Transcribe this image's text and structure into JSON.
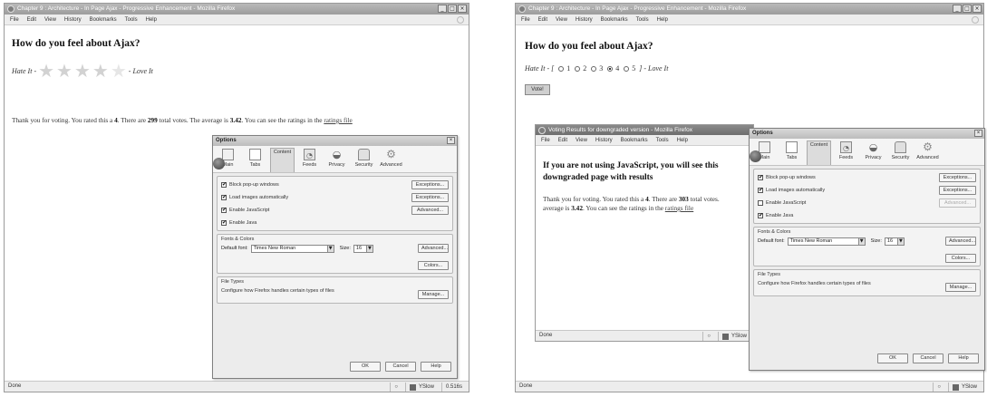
{
  "left_window": {
    "title": "Chapter 9 : Architecture - In Page Ajax - Progressive Enhancement - Mozilla Firefox",
    "menu": [
      "File",
      "Edit",
      "View",
      "History",
      "Bookmarks",
      "Tools",
      "Help"
    ],
    "question": "How do you feel about Ajax?",
    "hate_label": "Hate It -",
    "love_label": "- Love It",
    "stars_filled": 4,
    "stars_total": 5,
    "thanks": {
      "t1": "Thank you for voting. You rated this a",
      "rating": "4",
      "t2": ". There are",
      "votes": "299",
      "t3": "total votes. The average is",
      "avg": "3.42",
      "t4": ". You can see the ratings in the",
      "link": "ratings file"
    },
    "status": "Done",
    "status_yslow": "YSlow",
    "status_time": "0.516s"
  },
  "right_window": {
    "title": "Chapter 9 : Architecture - In Page Ajax - Progressive Enhancement - Mozilla Firefox",
    "menu": [
      "File",
      "Edit",
      "View",
      "History",
      "Bookmarks",
      "Tools",
      "Help"
    ],
    "question": "How do you feel about Ajax?",
    "hate_label": "Hate It - [",
    "love_label": "] - Love It",
    "radio_options": [
      "1",
      "2",
      "3",
      "4",
      "5"
    ],
    "radio_selected": "4",
    "vote_button": "Vote!",
    "status": "Done",
    "status_yslow": "YSlow"
  },
  "results_window": {
    "title": "Voting Results for downgraded version - Mozilla Firefox",
    "menu": [
      "File",
      "Edit",
      "View",
      "History",
      "Bookmarks",
      "Tools",
      "Help"
    ],
    "heading_line1": "If you are not using JavaScript, you will see this",
    "heading_line2": "downgraded page with results",
    "p1": "Thank you for voting. You rated this a",
    "rating": "4",
    "p2": ". There are",
    "votes": "303",
    "p3": "total votes.",
    "p4": "average is",
    "avg": "3.42",
    "p5": ". You can see the ratings in the",
    "link": "ratings file",
    "status": "Done",
    "status_yslow": "YSlow"
  },
  "options_left": {
    "title": "Options",
    "tabs": [
      "Main",
      "Tabs",
      "Content",
      "Feeds",
      "Privacy",
      "Security",
      "Advanced"
    ],
    "selected_tab": "Content",
    "checks": [
      {
        "label": "Block pop-up windows",
        "checked": true,
        "button": "Exceptions..."
      },
      {
        "label": "Load images automatically",
        "checked": true,
        "button": "Exceptions..."
      },
      {
        "label": "Enable JavaScript",
        "checked": true,
        "button": "Advanced..."
      },
      {
        "label": "Enable Java",
        "checked": true,
        "button": ""
      }
    ],
    "fonts_group": "Fonts & Colors",
    "default_font_label": "Default font:",
    "default_font": "Times New Roman",
    "size_label": "Size:",
    "size": "16",
    "advanced_button": "Advanced...",
    "colors_button": "Colors...",
    "filetypes_group": "File Types",
    "filetypes_text": "Configure how Firefox handles certain types of files",
    "manage_button": "Manage...",
    "ok": "OK",
    "cancel": "Cancel",
    "help": "Help"
  },
  "options_right": {
    "title": "Options",
    "tabs": [
      "Main",
      "Tabs",
      "Content",
      "Feeds",
      "Privacy",
      "Security",
      "Advanced"
    ],
    "selected_tab": "Content",
    "checks": [
      {
        "label": "Block pop-up windows",
        "checked": true,
        "button": "Exceptions..."
      },
      {
        "label": "Load images automatically",
        "checked": true,
        "button": "Exceptions..."
      },
      {
        "label": "Enable JavaScript",
        "checked": false,
        "button": "Advanced..."
      },
      {
        "label": "Enable Java",
        "checked": true,
        "button": ""
      }
    ],
    "fonts_group": "Fonts & Colors",
    "default_font_label": "Default font:",
    "default_font": "Times New Roman",
    "size_label": "Size:",
    "size": "16",
    "advanced_button": "Advanced...",
    "colors_button": "Colors...",
    "filetypes_group": "File Types",
    "filetypes_text": "Configure how Firefox handles certain types of files",
    "manage_button": "Manage...",
    "ok": "OK",
    "cancel": "Cancel",
    "help": "Help"
  },
  "icons": {
    "checkmark": "✔",
    "dropdown_arrow": "▼",
    "close": "×",
    "minimize": "_",
    "maximize": "□",
    "star": "★"
  }
}
